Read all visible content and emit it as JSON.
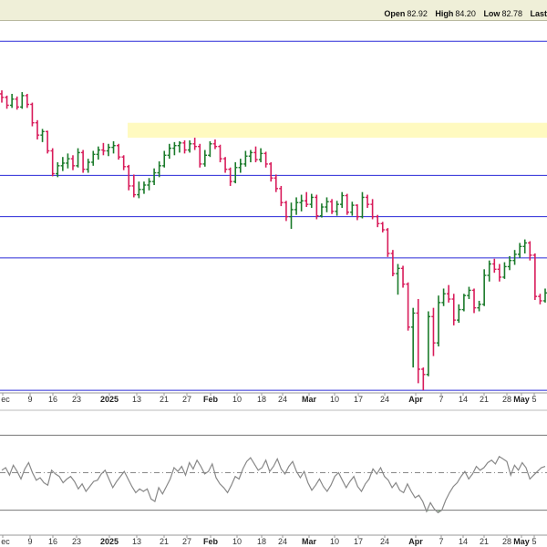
{
  "header": {
    "open_label": "Open",
    "open_value": "82.92",
    "high_label": "High",
    "high_value": "84.20",
    "low_label": "Low",
    "low_value": "82.78",
    "last_label": "Last"
  },
  "colors": {
    "up": "#1a7a2a",
    "down": "#d81b5a",
    "support_line": "#2a2ad8",
    "highlight_band": "#fffac0",
    "indicator_line": "#888888",
    "indicator_fill": "#6a9a6a",
    "panel_bg": "#efefd8"
  },
  "chart_data": [
    {
      "type": "ohlc",
      "x_axis": {
        "ticks": [
          "ec",
          "9",
          "16",
          "23",
          "2025",
          "13",
          "21",
          "27",
          "Feb",
          "10",
          "18",
          "24",
          "Mar",
          "10",
          "17",
          "24",
          "Apr",
          "7",
          "14",
          "21",
          "28",
          "May",
          "5"
        ],
        "bold_ticks": [
          "2025",
          "Feb",
          "Mar",
          "Apr",
          "May"
        ]
      },
      "ylim": [
        0,
        420
      ],
      "horizontal_lines": [
        400,
        247,
        200,
        153,
        2
      ],
      "highlight_band": [
        290,
        307
      ],
      "bars": [
        {
          "o": 340,
          "h": 344,
          "l": 330,
          "c": 336
        },
        {
          "o": 336,
          "h": 338,
          "l": 323,
          "c": 327
        },
        {
          "o": 327,
          "h": 340,
          "l": 324,
          "c": 334
        },
        {
          "o": 334,
          "h": 337,
          "l": 322,
          "c": 325
        },
        {
          "o": 325,
          "h": 342,
          "l": 323,
          "c": 338
        },
        {
          "o": 338,
          "h": 340,
          "l": 324,
          "c": 328
        },
        {
          "o": 328,
          "h": 330,
          "l": 303,
          "c": 307
        },
        {
          "o": 307,
          "h": 310,
          "l": 288,
          "c": 293
        },
        {
          "o": 293,
          "h": 300,
          "l": 285,
          "c": 297
        },
        {
          "o": 297,
          "h": 298,
          "l": 272,
          "c": 275
        },
        {
          "o": 275,
          "h": 278,
          "l": 246,
          "c": 249
        },
        {
          "o": 249,
          "h": 262,
          "l": 245,
          "c": 258
        },
        {
          "o": 258,
          "h": 268,
          "l": 252,
          "c": 261
        },
        {
          "o": 261,
          "h": 272,
          "l": 255,
          "c": 266
        },
        {
          "o": 266,
          "h": 270,
          "l": 253,
          "c": 258
        },
        {
          "o": 258,
          "h": 278,
          "l": 256,
          "c": 273
        },
        {
          "o": 273,
          "h": 276,
          "l": 250,
          "c": 254
        },
        {
          "o": 254,
          "h": 266,
          "l": 250,
          "c": 262
        },
        {
          "o": 262,
          "h": 275,
          "l": 258,
          "c": 271
        },
        {
          "o": 271,
          "h": 280,
          "l": 265,
          "c": 276
        },
        {
          "o": 276,
          "h": 284,
          "l": 270,
          "c": 275
        },
        {
          "o": 275,
          "h": 283,
          "l": 269,
          "c": 279
        },
        {
          "o": 279,
          "h": 286,
          "l": 272,
          "c": 281
        },
        {
          "o": 281,
          "h": 283,
          "l": 265,
          "c": 268
        },
        {
          "o": 268,
          "h": 270,
          "l": 253,
          "c": 257
        },
        {
          "o": 257,
          "h": 259,
          "l": 230,
          "c": 235
        },
        {
          "o": 235,
          "h": 248,
          "l": 222,
          "c": 225
        },
        {
          "o": 225,
          "h": 240,
          "l": 221,
          "c": 231
        },
        {
          "o": 231,
          "h": 240,
          "l": 226,
          "c": 236
        },
        {
          "o": 236,
          "h": 244,
          "l": 230,
          "c": 240
        },
        {
          "o": 240,
          "h": 255,
          "l": 236,
          "c": 250
        },
        {
          "o": 250,
          "h": 263,
          "l": 245,
          "c": 258
        },
        {
          "o": 258,
          "h": 275,
          "l": 256,
          "c": 270
        },
        {
          "o": 270,
          "h": 283,
          "l": 266,
          "c": 278
        },
        {
          "o": 278,
          "h": 285,
          "l": 270,
          "c": 281
        },
        {
          "o": 281,
          "h": 286,
          "l": 273,
          "c": 284
        },
        {
          "o": 284,
          "h": 287,
          "l": 272,
          "c": 276
        },
        {
          "o": 276,
          "h": 287,
          "l": 273,
          "c": 283
        },
        {
          "o": 283,
          "h": 290,
          "l": 276,
          "c": 280
        },
        {
          "o": 280,
          "h": 283,
          "l": 256,
          "c": 260
        },
        {
          "o": 260,
          "h": 276,
          "l": 257,
          "c": 270
        },
        {
          "o": 270,
          "h": 286,
          "l": 268,
          "c": 283
        },
        {
          "o": 283,
          "h": 288,
          "l": 277,
          "c": 280
        },
        {
          "o": 280,
          "h": 282,
          "l": 262,
          "c": 266
        },
        {
          "o": 266,
          "h": 268,
          "l": 250,
          "c": 254
        },
        {
          "o": 254,
          "h": 256,
          "l": 235,
          "c": 240
        },
        {
          "o": 240,
          "h": 262,
          "l": 238,
          "c": 256
        },
        {
          "o": 256,
          "h": 266,
          "l": 250,
          "c": 260
        },
        {
          "o": 260,
          "h": 275,
          "l": 257,
          "c": 269
        },
        {
          "o": 269,
          "h": 276,
          "l": 262,
          "c": 273
        },
        {
          "o": 273,
          "h": 280,
          "l": 262,
          "c": 265
        },
        {
          "o": 265,
          "h": 278,
          "l": 262,
          "c": 272
        },
        {
          "o": 272,
          "h": 274,
          "l": 256,
          "c": 260
        },
        {
          "o": 260,
          "h": 262,
          "l": 240,
          "c": 244
        },
        {
          "o": 244,
          "h": 248,
          "l": 228,
          "c": 232
        },
        {
          "o": 232,
          "h": 235,
          "l": 212,
          "c": 216
        },
        {
          "o": 216,
          "h": 218,
          "l": 195,
          "c": 200
        },
        {
          "o": 200,
          "h": 216,
          "l": 186,
          "c": 208
        },
        {
          "o": 208,
          "h": 222,
          "l": 202,
          "c": 216
        },
        {
          "o": 216,
          "h": 225,
          "l": 206,
          "c": 218
        },
        {
          "o": 218,
          "h": 228,
          "l": 211,
          "c": 214
        },
        {
          "o": 214,
          "h": 226,
          "l": 210,
          "c": 222
        },
        {
          "o": 222,
          "h": 225,
          "l": 197,
          "c": 201
        },
        {
          "o": 201,
          "h": 215,
          "l": 199,
          "c": 211
        },
        {
          "o": 211,
          "h": 222,
          "l": 205,
          "c": 217
        },
        {
          "o": 217,
          "h": 220,
          "l": 203,
          "c": 206
        },
        {
          "o": 206,
          "h": 218,
          "l": 201,
          "c": 214
        },
        {
          "o": 214,
          "h": 228,
          "l": 210,
          "c": 224
        },
        {
          "o": 224,
          "h": 226,
          "l": 202,
          "c": 205
        },
        {
          "o": 205,
          "h": 217,
          "l": 201,
          "c": 213
        },
        {
          "o": 213,
          "h": 214,
          "l": 196,
          "c": 200
        },
        {
          "o": 200,
          "h": 228,
          "l": 198,
          "c": 222
        },
        {
          "o": 222,
          "h": 225,
          "l": 210,
          "c": 214
        },
        {
          "o": 214,
          "h": 220,
          "l": 197,
          "c": 200
        },
        {
          "o": 200,
          "h": 202,
          "l": 188,
          "c": 192
        },
        {
          "o": 192,
          "h": 194,
          "l": 182,
          "c": 185
        },
        {
          "o": 185,
          "h": 187,
          "l": 154,
          "c": 158
        },
        {
          "o": 158,
          "h": 162,
          "l": 132,
          "c": 135
        },
        {
          "o": 135,
          "h": 146,
          "l": 111,
          "c": 141
        },
        {
          "o": 141,
          "h": 144,
          "l": 119,
          "c": 123
        },
        {
          "o": 123,
          "h": 125,
          "l": 70,
          "c": 74
        },
        {
          "o": 74,
          "h": 96,
          "l": 28,
          "c": 90
        },
        {
          "o": 90,
          "h": 106,
          "l": 10,
          "c": 26
        },
        {
          "o": 26,
          "h": 28,
          "l": 2,
          "c": 20
        },
        {
          "o": 20,
          "h": 92,
          "l": 18,
          "c": 86
        },
        {
          "o": 86,
          "h": 96,
          "l": 41,
          "c": 56
        },
        {
          "o": 56,
          "h": 110,
          "l": 52,
          "c": 102
        },
        {
          "o": 102,
          "h": 118,
          "l": 98,
          "c": 112
        },
        {
          "o": 112,
          "h": 122,
          "l": 102,
          "c": 106
        },
        {
          "o": 106,
          "h": 112,
          "l": 76,
          "c": 82
        },
        {
          "o": 82,
          "h": 100,
          "l": 79,
          "c": 94
        },
        {
          "o": 94,
          "h": 112,
          "l": 92,
          "c": 110
        },
        {
          "o": 110,
          "h": 120,
          "l": 106,
          "c": 116
        },
        {
          "o": 116,
          "h": 118,
          "l": 90,
          "c": 96
        },
        {
          "o": 96,
          "h": 104,
          "l": 92,
          "c": 100
        },
        {
          "o": 100,
          "h": 140,
          "l": 98,
          "c": 133
        },
        {
          "o": 133,
          "h": 150,
          "l": 126,
          "c": 146
        },
        {
          "o": 146,
          "h": 152,
          "l": 136,
          "c": 140
        },
        {
          "o": 140,
          "h": 146,
          "l": 126,
          "c": 131
        },
        {
          "o": 131,
          "h": 148,
          "l": 129,
          "c": 143
        },
        {
          "o": 143,
          "h": 155,
          "l": 139,
          "c": 150
        },
        {
          "o": 150,
          "h": 162,
          "l": 145,
          "c": 157
        },
        {
          "o": 157,
          "h": 170,
          "l": 153,
          "c": 166
        },
        {
          "o": 166,
          "h": 174,
          "l": 158,
          "c": 170
        },
        {
          "o": 170,
          "h": 172,
          "l": 150,
          "c": 156
        },
        {
          "o": 156,
          "h": 158,
          "l": 105,
          "c": 109
        },
        {
          "o": 109,
          "h": 112,
          "l": 100,
          "c": 104
        },
        {
          "o": 104,
          "h": 118,
          "l": 102,
          "c": 113
        }
      ]
    },
    {
      "type": "line",
      "ylim": [
        0,
        100
      ],
      "reference_lines": [
        80,
        50,
        20
      ],
      "dashed_line": 50,
      "values": [
        52,
        54,
        48,
        56,
        51,
        45,
        53,
        58,
        50,
        44,
        46,
        42,
        40,
        52,
        49,
        47,
        42,
        45,
        47,
        43,
        37,
        41,
        35,
        39,
        43,
        44,
        49,
        52,
        45,
        38,
        43,
        47,
        51,
        45,
        39,
        34,
        37,
        35,
        37,
        29,
        27,
        38,
        33,
        39,
        45,
        54,
        51,
        55,
        48,
        58,
        53,
        60,
        55,
        49,
        51,
        57,
        46,
        41,
        38,
        34,
        40,
        47,
        45,
        53,
        59,
        62,
        57,
        52,
        54,
        60,
        51,
        55,
        61,
        53,
        49,
        55,
        59,
        51,
        46,
        51,
        42,
        36,
        40,
        45,
        39,
        35,
        40,
        47,
        50,
        44,
        38,
        43,
        47,
        39,
        35,
        41,
        45,
        53,
        49,
        54,
        47,
        44,
        38,
        42,
        36,
        34,
        41,
        35,
        30,
        32,
        27,
        19,
        26,
        21,
        18,
        20,
        28,
        34,
        39,
        42,
        47,
        51,
        45,
        49,
        55,
        52,
        54,
        58,
        60,
        57,
        63,
        61,
        59,
        48,
        56,
        52,
        58,
        54,
        45,
        48,
        51,
        54,
        55
      ],
      "fill_below": 20
    }
  ]
}
